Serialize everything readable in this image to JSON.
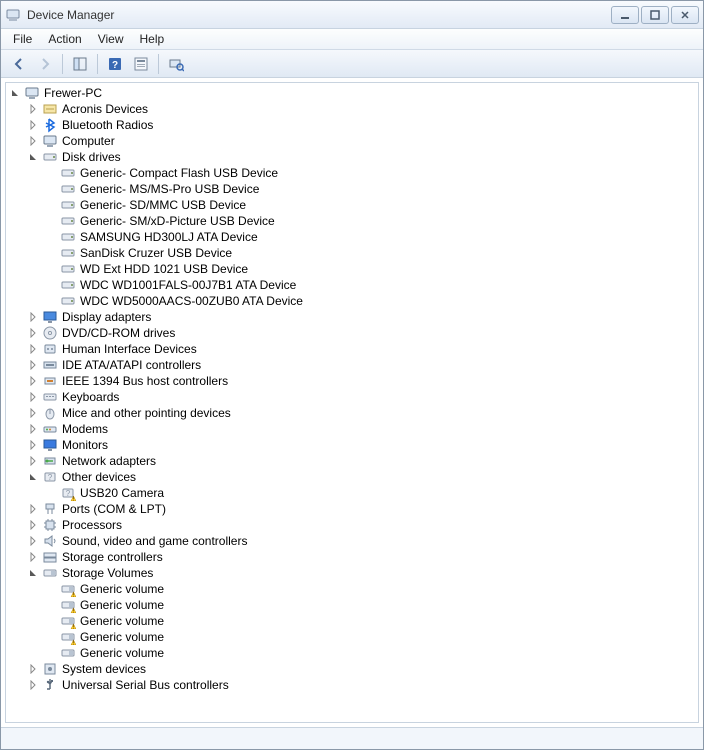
{
  "window": {
    "title": "Device Manager"
  },
  "menu": {
    "file": "File",
    "action": "Action",
    "view": "View",
    "help": "Help"
  },
  "tree": [
    {
      "depth": 0,
      "state": "open",
      "icon": "computer",
      "label": "Frewer-PC",
      "warn": false
    },
    {
      "depth": 1,
      "state": "closed",
      "icon": "acronis",
      "label": "Acronis Devices",
      "warn": false
    },
    {
      "depth": 1,
      "state": "closed",
      "icon": "bluetooth",
      "label": "Bluetooth Radios",
      "warn": false
    },
    {
      "depth": 1,
      "state": "closed",
      "icon": "computer",
      "label": "Computer",
      "warn": false
    },
    {
      "depth": 1,
      "state": "open",
      "icon": "disk",
      "label": "Disk drives",
      "warn": false
    },
    {
      "depth": 2,
      "state": "none",
      "icon": "disk",
      "label": "Generic- Compact Flash USB Device",
      "warn": false
    },
    {
      "depth": 2,
      "state": "none",
      "icon": "disk",
      "label": "Generic- MS/MS-Pro USB Device",
      "warn": false
    },
    {
      "depth": 2,
      "state": "none",
      "icon": "disk",
      "label": "Generic- SD/MMC USB Device",
      "warn": false
    },
    {
      "depth": 2,
      "state": "none",
      "icon": "disk",
      "label": "Generic- SM/xD-Picture USB Device",
      "warn": false
    },
    {
      "depth": 2,
      "state": "none",
      "icon": "disk",
      "label": "SAMSUNG HD300LJ ATA Device",
      "warn": false
    },
    {
      "depth": 2,
      "state": "none",
      "icon": "disk",
      "label": "SanDisk Cruzer USB Device",
      "warn": false
    },
    {
      "depth": 2,
      "state": "none",
      "icon": "disk",
      "label": "WD Ext HDD 1021 USB Device",
      "warn": false
    },
    {
      "depth": 2,
      "state": "none",
      "icon": "disk",
      "label": "WDC WD1001FALS-00J7B1 ATA Device",
      "warn": false
    },
    {
      "depth": 2,
      "state": "none",
      "icon": "disk",
      "label": "WDC WD5000AACS-00ZUB0 ATA Device",
      "warn": false
    },
    {
      "depth": 1,
      "state": "closed",
      "icon": "display",
      "label": "Display adapters",
      "warn": false
    },
    {
      "depth": 1,
      "state": "closed",
      "icon": "dvd",
      "label": "DVD/CD-ROM drives",
      "warn": false
    },
    {
      "depth": 1,
      "state": "closed",
      "icon": "hid",
      "label": "Human Interface Devices",
      "warn": false
    },
    {
      "depth": 1,
      "state": "closed",
      "icon": "ide",
      "label": "IDE ATA/ATAPI controllers",
      "warn": false
    },
    {
      "depth": 1,
      "state": "closed",
      "icon": "ieee",
      "label": "IEEE 1394 Bus host controllers",
      "warn": false
    },
    {
      "depth": 1,
      "state": "closed",
      "icon": "keyboard",
      "label": "Keyboards",
      "warn": false
    },
    {
      "depth": 1,
      "state": "closed",
      "icon": "mouse",
      "label": "Mice and other pointing devices",
      "warn": false
    },
    {
      "depth": 1,
      "state": "closed",
      "icon": "modem",
      "label": "Modems",
      "warn": false
    },
    {
      "depth": 1,
      "state": "closed",
      "icon": "monitor",
      "label": "Monitors",
      "warn": false
    },
    {
      "depth": 1,
      "state": "closed",
      "icon": "network",
      "label": "Network adapters",
      "warn": false
    },
    {
      "depth": 1,
      "state": "open",
      "icon": "other",
      "label": "Other devices",
      "warn": false
    },
    {
      "depth": 2,
      "state": "none",
      "icon": "other",
      "label": "USB20 Camera",
      "warn": true
    },
    {
      "depth": 1,
      "state": "closed",
      "icon": "port",
      "label": "Ports (COM & LPT)",
      "warn": false
    },
    {
      "depth": 1,
      "state": "closed",
      "icon": "processor",
      "label": "Processors",
      "warn": false
    },
    {
      "depth": 1,
      "state": "closed",
      "icon": "sound",
      "label": "Sound, video and game controllers",
      "warn": false
    },
    {
      "depth": 1,
      "state": "closed",
      "icon": "storagectl",
      "label": "Storage controllers",
      "warn": false
    },
    {
      "depth": 1,
      "state": "open",
      "icon": "volume",
      "label": "Storage Volumes",
      "warn": false
    },
    {
      "depth": 2,
      "state": "none",
      "icon": "volume",
      "label": "Generic volume",
      "warn": true
    },
    {
      "depth": 2,
      "state": "none",
      "icon": "volume",
      "label": "Generic volume",
      "warn": true
    },
    {
      "depth": 2,
      "state": "none",
      "icon": "volume",
      "label": "Generic volume",
      "warn": true
    },
    {
      "depth": 2,
      "state": "none",
      "icon": "volume",
      "label": "Generic volume",
      "warn": true
    },
    {
      "depth": 2,
      "state": "none",
      "icon": "volume",
      "label": "Generic volume",
      "warn": false
    },
    {
      "depth": 1,
      "state": "closed",
      "icon": "system",
      "label": "System devices",
      "warn": false
    },
    {
      "depth": 1,
      "state": "closed",
      "icon": "usb",
      "label": "Universal Serial Bus controllers",
      "warn": false
    }
  ]
}
